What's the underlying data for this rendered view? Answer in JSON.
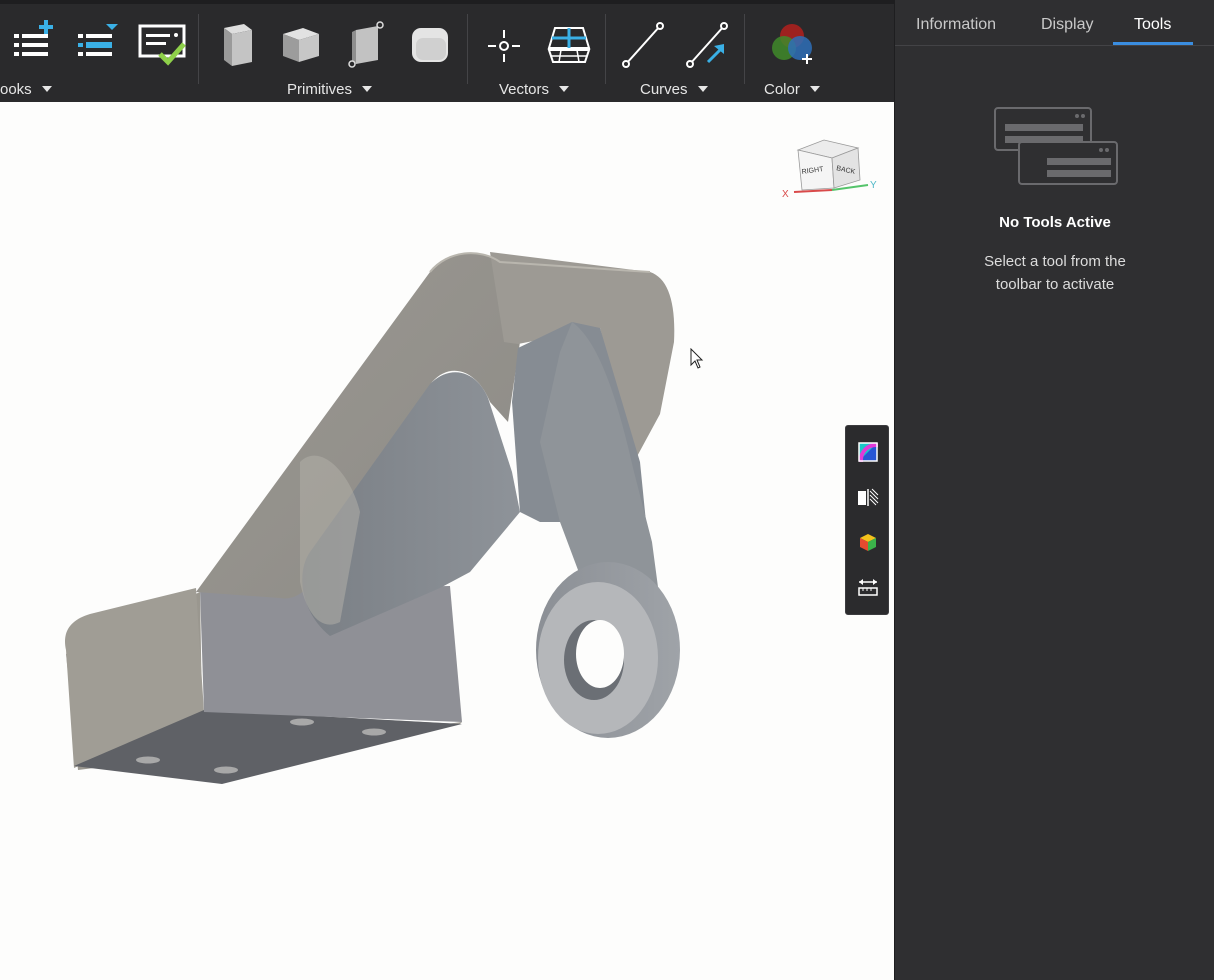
{
  "toolbar": {
    "groups": [
      {
        "label": "ooks"
      },
      {
        "label": "Primitives"
      },
      {
        "label": "Vectors"
      },
      {
        "label": "Curves"
      },
      {
        "label": "Color"
      }
    ]
  },
  "panel": {
    "tabs": [
      {
        "label": "Information"
      },
      {
        "label": "Display"
      },
      {
        "label": "Tools"
      }
    ],
    "active_tab": "Tools",
    "empty_title": "No Tools Active",
    "empty_message": "Select a tool from the toolbar to activate"
  },
  "viewcube": {
    "faces": {
      "right": "RIGHT",
      "back": "BACK"
    },
    "axes": {
      "x": "X",
      "y": "Y"
    }
  },
  "colors": {
    "accent": "#3a8de0",
    "toolbar_bg": "#2a2a2c",
    "panel_bg": "#2f2f31",
    "viewport_bg": "#fdfdfc"
  }
}
